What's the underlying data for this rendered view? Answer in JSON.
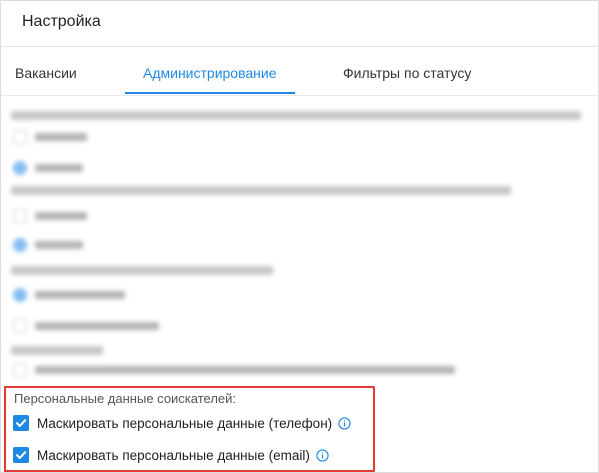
{
  "header": {
    "title": "Настройка"
  },
  "tabs": [
    {
      "label": "Вакансии",
      "active": false
    },
    {
      "label": "Администрирование",
      "active": true
    },
    {
      "label": "Фильтры по статусу",
      "active": false
    }
  ],
  "colors": {
    "accent": "#1e88e5",
    "highlight_border": "#e53935"
  },
  "personal_data": {
    "section_label": "Персональные данные соискателей:",
    "options": [
      {
        "label": "Маскировать персональные данные (телефон)",
        "checked": true,
        "icon": "info-icon"
      },
      {
        "label": "Маскировать персональные данные (email)",
        "checked": true,
        "icon": "info-icon"
      }
    ]
  }
}
